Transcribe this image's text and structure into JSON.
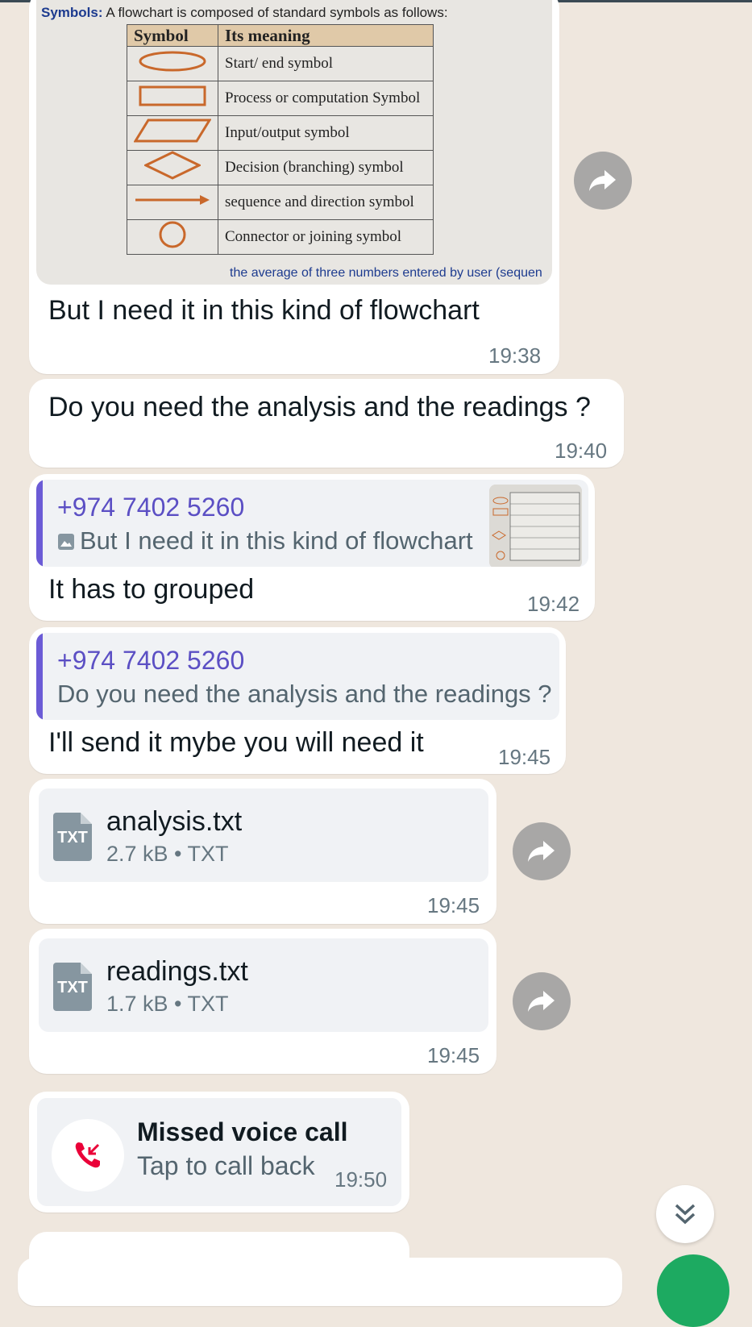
{
  "colors": {
    "accent": "#1daa61",
    "quote_bar": "#6b5bd6",
    "missed_call": "#ea0038"
  },
  "messages": {
    "image_msg": {
      "image": {
        "title_bold": "Symbols:",
        "title_rest": " A flowchart is composed of standard symbols as follows:",
        "col_symbol": "Symbol",
        "col_meaning": "Its meaning",
        "rows": [
          {
            "shape": "oval",
            "meaning": "Start/ end symbol"
          },
          {
            "shape": "rect",
            "meaning": "Process or computation Symbol"
          },
          {
            "shape": "parallelogram",
            "meaning": "Input/output symbol"
          },
          {
            "shape": "diamond",
            "meaning": "Decision (branching) symbol"
          },
          {
            "shape": "arrow",
            "meaning": "sequence and direction symbol"
          },
          {
            "shape": "circle",
            "meaning": "Connector or joining symbol"
          }
        ],
        "footer_text": "the average of three numbers entered by user (sequen"
      },
      "caption": "But I need it in this kind of flowchart",
      "time": "19:38"
    },
    "question_msg": {
      "text": "Do you need the analysis and the readings ?",
      "time": "19:40"
    },
    "reply_grouped": {
      "quote_sender": "+974 7402 5260",
      "quote_text": "But I need it in this kind of flowchart",
      "text": "It has to grouped",
      "time": "19:42"
    },
    "reply_send": {
      "quote_sender": "+974 7402 5260",
      "quote_text": "Do you need the analysis and the readings ?",
      "text": "I'll send it mybe you will need it",
      "time": "19:45"
    },
    "file_analysis": {
      "ext": "TXT",
      "name": "analysis.txt",
      "meta": "2.7 kB • TXT",
      "time": "19:45"
    },
    "file_readings": {
      "ext": "TXT",
      "name": "readings.txt",
      "meta": "1.7 kB • TXT",
      "time": "19:45"
    },
    "missed_call": {
      "title": "Missed voice call",
      "subtitle": "Tap to call back",
      "time": "19:50"
    }
  },
  "icons": {
    "forward": "forward-arrow-icon",
    "missed_call": "missed-call-icon",
    "scroll_down": "double-chevron-down-icon",
    "file": "txt-file-icon"
  }
}
